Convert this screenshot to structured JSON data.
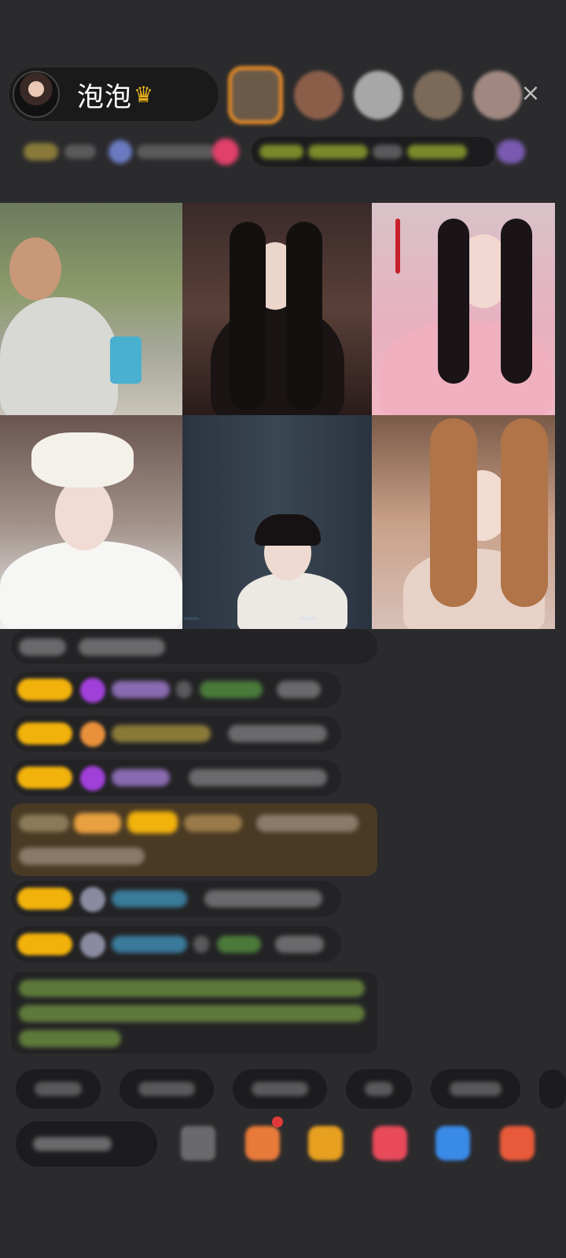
{
  "host": {
    "name": "泡泡",
    "crown_icon": "crown-icon"
  },
  "viewers": [
    "viewer-avatar-1",
    "viewer-avatar-2",
    "viewer-avatar-3",
    "viewer-avatar-4",
    "viewer-avatar-5"
  ],
  "close_icon": "×",
  "colors": {
    "background": "#2b2b2d",
    "pill": "#1a1a1a",
    "level_badge": "#f2b20c",
    "gift_card": "#4a3a24",
    "accent_orange": "#e48a28"
  },
  "video_tiles": [
    "guest-1",
    "guest-2",
    "guest-3",
    "guest-4",
    "guest-5",
    "guest-6"
  ],
  "bottom_bar_icons": [
    "keyboard-icon",
    "gift-box-icon",
    "gift-icon",
    "red-packet-icon",
    "game-icon",
    "more-apps-icon"
  ]
}
